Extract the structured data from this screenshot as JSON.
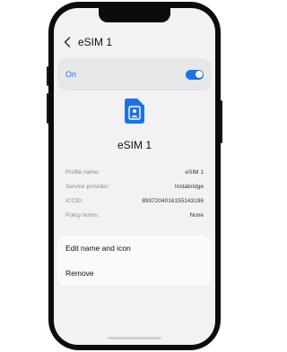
{
  "header": {
    "title": "eSIM 1"
  },
  "toggle_row": {
    "label": "On",
    "enabled": true,
    "accent_color": "#1a73e8"
  },
  "sim": {
    "name": "eSIM 1",
    "icon": "sim-card-person-icon"
  },
  "details": [
    {
      "label": "Profile name:",
      "value": "eSIM 1"
    },
    {
      "label": "Service provider:",
      "value": "Instabridge"
    },
    {
      "label": "ICCID:",
      "value": "8937204016155143196"
    },
    {
      "label": "Policy terms:",
      "value": "None"
    }
  ],
  "actions": {
    "edit_label": "Edit name and icon",
    "remove_label": "Remove"
  }
}
